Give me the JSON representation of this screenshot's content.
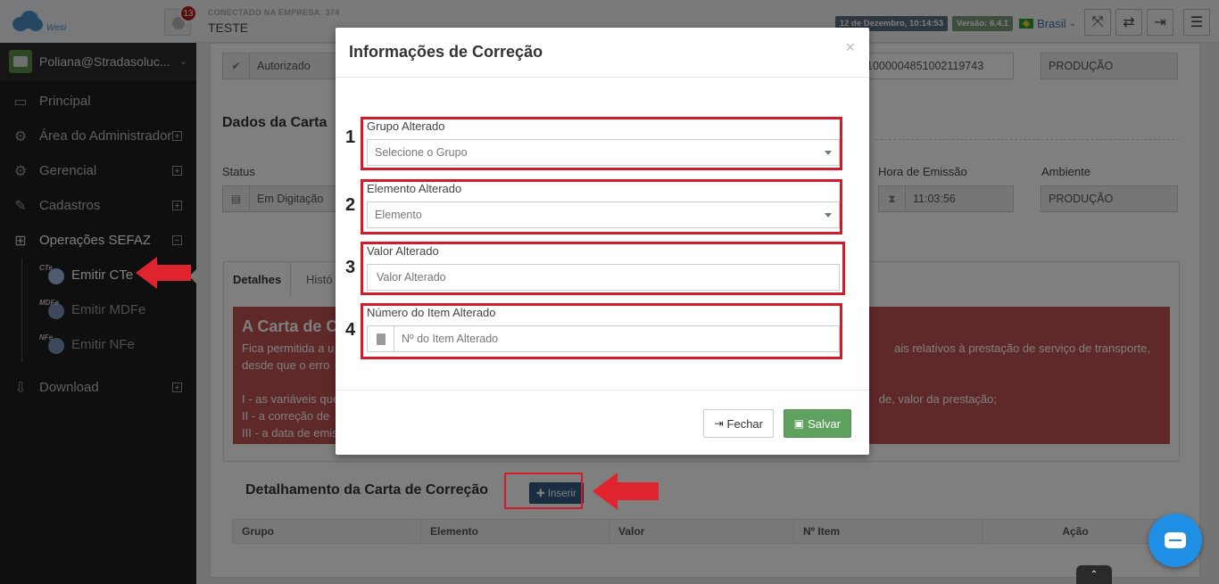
{
  "app": {
    "logo_text": "Wesi"
  },
  "topbar": {
    "notification_count": "13",
    "company_label": "CONECTADO NA EMPRESA: 374",
    "company_name": "TESTE",
    "datetime": "12 de Dezembro, 10:14:53",
    "version": "Versão: 6.4.1",
    "language": "Brasil"
  },
  "sidebar": {
    "user": "Poliana@Stradasoluc...",
    "items": [
      {
        "label": "Principal"
      },
      {
        "label": "Área do Administrador"
      },
      {
        "label": "Gerencial"
      },
      {
        "label": "Cadastros"
      },
      {
        "label": "Operações SEFAZ"
      }
    ],
    "subitems": [
      {
        "tag": "CTe",
        "label": "Emitir CTe"
      },
      {
        "tag": "MDFe",
        "label": "Emitir MDFe"
      },
      {
        "tag": "NFe",
        "label": "Emitir NFe"
      }
    ],
    "download": "Download"
  },
  "page": {
    "status_top": "Autorizado",
    "key_value": "1000004851002119743",
    "ambiente_top": "PRODUÇÃO",
    "section_title": "Dados da Carta",
    "status_label": "Status",
    "status_value": "Em Digitação",
    "hora_label": "Hora de Emissão",
    "hora_value": "11:03:56",
    "ambiente_label": "Ambiente",
    "ambiente_value": "PRODUÇÃO",
    "tab_details": "Detalhes",
    "tab_history": "Histó",
    "alert_title": "A Carta de C",
    "alert_line1_left": "Fica permitida a u",
    "alert_line1_right": "ais relativos à prestação de serviço de transporte,",
    "alert_line2": "desde que o erro",
    "alert_line3_left": "I - as variáveis que",
    "alert_line3_right": "de, valor da prestação;",
    "alert_line4": "II - a correção de",
    "alert_line5": "III - a data de emis",
    "detail_title": "Detalhamento da Carta de Correção",
    "insert_button": "Inserir",
    "table_headers": [
      "Grupo",
      "Elemento",
      "Valor",
      "Nº Item",
      "Ação"
    ]
  },
  "modal": {
    "title": "Informações de Correção",
    "close": "×",
    "fields": [
      {
        "number": "1",
        "label": "Grupo Alterado",
        "placeholder": "Selecione o Grupo"
      },
      {
        "number": "2",
        "label": "Elemento Alterado",
        "placeholder": "Elemento"
      },
      {
        "number": "3",
        "label": "Valor Alterado",
        "placeholder": "Valor Alterado"
      },
      {
        "number": "4",
        "label": "Número do Item Alterado",
        "placeholder": "Nº do Item Alterado"
      }
    ],
    "close_button": "Fechar",
    "save_button": "Salvar"
  },
  "colors": {
    "annotation_red": "#d21b2a",
    "save_green": "#5fa25f",
    "insert_blue": "#325d86",
    "alert_red": "#c05252"
  }
}
